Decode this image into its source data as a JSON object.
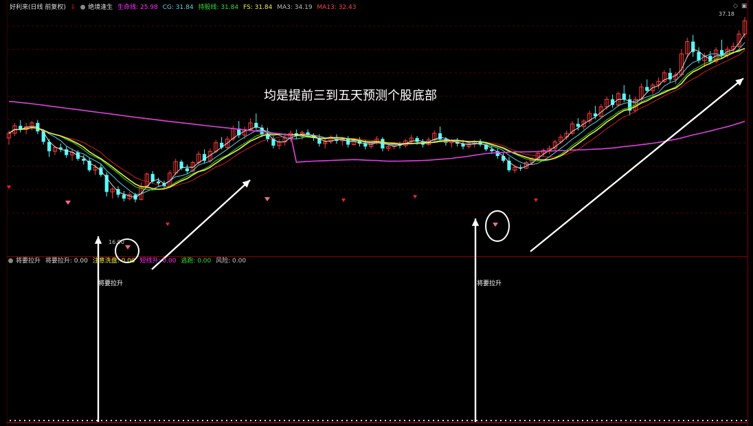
{
  "header": {
    "stock_title": "好利来(日线 前复权)",
    "indicator_name": "绝境逢生",
    "shengming_label": "生命线: 25.98",
    "cg_label": "CG: 31.84",
    "chigu_label": "持股线: 31.84",
    "fs_label": "FS: 31.84",
    "ma3_label": "MA3: 34.19",
    "ma13_label": "MA13: 32.43"
  },
  "sub_header": {
    "indicator_name": "将要拉升",
    "jiangyao_label": "将要拉升: 0.00",
    "zhuyi_label": "注意洗盘: 0.00",
    "jianting_label": "短线升: 0.00",
    "taopao_label": "逃跑: 0.00",
    "fengxian_label": "风险: 0.00"
  },
  "top_right": {
    "icon1": "◇",
    "icon2": "▣"
  },
  "chart_data": {
    "type": "candlestick",
    "title": "",
    "price_max_label": "37.18",
    "price_min_label": "16.90",
    "annotation": "均是提前三到五天预测个股底部",
    "signal_label": "将要拉升",
    "ylim": [
      14.0,
      39.0
    ],
    "candles": [
      [
        26.0,
        26.8,
        25.3,
        26.5
      ],
      [
        26.5,
        27.6,
        26.2,
        27.3
      ],
      [
        27.3,
        27.9,
        26.6,
        26.9
      ],
      [
        26.9,
        27.6,
        26.4,
        27.2
      ],
      [
        27.2,
        27.8,
        26.8,
        27.6
      ],
      [
        27.6,
        27.9,
        26.4,
        26.7
      ],
      [
        26.7,
        26.9,
        25.3,
        25.6
      ],
      [
        25.6,
        25.9,
        24.0,
        24.6
      ],
      [
        24.6,
        25.2,
        24.2,
        25.0
      ],
      [
        25.0,
        25.4,
        24.5,
        24.8
      ],
      [
        24.8,
        25.1,
        23.9,
        24.2
      ],
      [
        24.2,
        24.9,
        23.6,
        24.5
      ],
      [
        24.5,
        24.7,
        23.6,
        23.8
      ],
      [
        23.8,
        24.2,
        23.2,
        23.6
      ],
      [
        23.6,
        23.9,
        22.4,
        22.6
      ],
      [
        22.6,
        23.2,
        22.1,
        22.9
      ],
      [
        22.9,
        23.2,
        21.9,
        22.1
      ],
      [
        22.1,
        22.4,
        19.8,
        20.3
      ],
      [
        20.3,
        20.8,
        19.6,
        20.6
      ],
      [
        20.6,
        20.9,
        19.7,
        20.0
      ],
      [
        20.0,
        20.4,
        19.3,
        19.6
      ],
      [
        19.6,
        20.3,
        19.4,
        20.0
      ],
      [
        20.0,
        20.2,
        19.2,
        19.5
      ],
      [
        19.5,
        21.3,
        19.4,
        20.9
      ],
      [
        20.9,
        22.4,
        20.7,
        22.2
      ],
      [
        22.2,
        22.5,
        21.2,
        21.4
      ],
      [
        21.4,
        21.8,
        20.8,
        21.2
      ],
      [
        21.2,
        21.5,
        20.6,
        20.9
      ],
      [
        20.9,
        22.6,
        20.8,
        22.3
      ],
      [
        22.3,
        23.8,
        22.1,
        23.5
      ],
      [
        23.5,
        23.7,
        22.6,
        22.8
      ],
      [
        22.8,
        23.2,
        22.2,
        22.5
      ],
      [
        22.5,
        23.6,
        22.4,
        23.4
      ],
      [
        23.4,
        24.6,
        23.2,
        24.3
      ],
      [
        24.3,
        24.8,
        23.3,
        23.6
      ],
      [
        23.6,
        24.9,
        23.4,
        24.6
      ],
      [
        24.6,
        25.8,
        24.4,
        25.5
      ],
      [
        25.5,
        26.1,
        24.8,
        25.0
      ],
      [
        25.0,
        26.2,
        24.8,
        25.9
      ],
      [
        25.9,
        27.3,
        25.7,
        27.0
      ],
      [
        27.0,
        27.8,
        26.0,
        26.3
      ],
      [
        26.3,
        27.2,
        25.9,
        26.9
      ],
      [
        26.9,
        28.1,
        26.7,
        27.6
      ],
      [
        27.6,
        28.6,
        26.9,
        27.1
      ],
      [
        27.1,
        27.4,
        26.1,
        26.4
      ],
      [
        26.4,
        27.1,
        25.6,
        25.9
      ],
      [
        25.9,
        26.2,
        24.9,
        25.2
      ],
      [
        25.2,
        25.9,
        24.8,
        25.6
      ],
      [
        25.6,
        26.3,
        25.2,
        26.0
      ],
      [
        26.0,
        26.8,
        25.6,
        26.5
      ],
      [
        26.5,
        26.9,
        25.9,
        26.2
      ],
      [
        26.2,
        26.8,
        25.8,
        26.6
      ],
      [
        26.6,
        26.9,
        26.1,
        26.3
      ],
      [
        26.3,
        26.5,
        25.7,
        26.0
      ],
      [
        26.0,
        26.4,
        25.1,
        25.4
      ],
      [
        25.4,
        25.9,
        24.9,
        25.6
      ],
      [
        25.6,
        26.3,
        25.4,
        26.1
      ],
      [
        26.1,
        26.4,
        25.4,
        25.7
      ],
      [
        25.7,
        26.1,
        25.2,
        25.9
      ],
      [
        25.9,
        26.2,
        25.0,
        25.3
      ],
      [
        25.3,
        26.0,
        25.2,
        25.8
      ],
      [
        25.8,
        26.1,
        25.1,
        25.4
      ],
      [
        25.4,
        25.8,
        24.8,
        25.1
      ],
      [
        25.1,
        25.6,
        24.9,
        25.5
      ],
      [
        25.5,
        26.2,
        25.3,
        25.9
      ],
      [
        25.9,
        26.1,
        24.6,
        24.9
      ],
      [
        24.9,
        25.3,
        24.6,
        25.1
      ],
      [
        25.1,
        25.6,
        24.8,
        25.4
      ],
      [
        25.4,
        25.6,
        24.9,
        25.2
      ],
      [
        25.2,
        25.9,
        25.0,
        25.7
      ],
      [
        25.7,
        26.3,
        25.4,
        26.0
      ],
      [
        26.0,
        26.2,
        25.3,
        25.6
      ],
      [
        25.6,
        25.9,
        25.0,
        25.3
      ],
      [
        25.3,
        26.1,
        25.2,
        25.8
      ],
      [
        25.8,
        26.8,
        25.6,
        26.5
      ],
      [
        26.5,
        27.2,
        25.6,
        25.9
      ],
      [
        25.9,
        26.1,
        25.2,
        25.5
      ],
      [
        25.5,
        25.9,
        25.0,
        25.7
      ],
      [
        25.7,
        26.0,
        25.1,
        25.4
      ],
      [
        25.4,
        25.8,
        24.8,
        25.1
      ],
      [
        25.1,
        25.7,
        24.9,
        25.4
      ],
      [
        25.4,
        25.8,
        25.0,
        25.6
      ],
      [
        25.6,
        25.9,
        25.1,
        25.3
      ],
      [
        25.3,
        25.6,
        24.6,
        24.8
      ],
      [
        24.8,
        25.2,
        24.3,
        24.6
      ],
      [
        24.6,
        24.9,
        23.8,
        24.1
      ],
      [
        24.1,
        24.4,
        23.4,
        23.6
      ],
      [
        23.6,
        24.0,
        22.4,
        22.6
      ],
      [
        22.6,
        23.1,
        22.3,
        22.9
      ],
      [
        22.9,
        23.2,
        22.5,
        22.8
      ],
      [
        22.8,
        23.6,
        22.7,
        23.4
      ],
      [
        23.4,
        24.0,
        23.2,
        23.8
      ],
      [
        23.8,
        24.6,
        23.6,
        24.4
      ],
      [
        24.4,
        24.9,
        24.0,
        24.7
      ],
      [
        24.7,
        25.2,
        24.3,
        24.9
      ],
      [
        24.9,
        25.8,
        24.7,
        25.6
      ],
      [
        25.6,
        26.4,
        25.4,
        26.1
      ],
      [
        26.1,
        26.8,
        25.8,
        26.5
      ],
      [
        26.5,
        27.8,
        26.3,
        27.5
      ],
      [
        27.5,
        28.1,
        26.8,
        27.2
      ],
      [
        27.2,
        28.0,
        26.9,
        27.8
      ],
      [
        27.8,
        28.9,
        27.5,
        28.6
      ],
      [
        28.6,
        29.4,
        28.0,
        28.3
      ],
      [
        28.3,
        29.6,
        28.1,
        29.3
      ],
      [
        29.3,
        30.4,
        29.0,
        30.1
      ],
      [
        30.1,
        30.6,
        29.2,
        29.5
      ],
      [
        29.5,
        30.9,
        29.3,
        30.7
      ],
      [
        30.7,
        31.6,
        29.8,
        30.1
      ],
      [
        30.1,
        30.6,
        28.4,
        28.9
      ],
      [
        28.9,
        30.4,
        28.7,
        30.1
      ],
      [
        30.1,
        31.8,
        29.9,
        31.4
      ],
      [
        31.4,
        32.2,
        30.8,
        31.0
      ],
      [
        31.0,
        31.8,
        30.6,
        31.6
      ],
      [
        31.6,
        32.4,
        31.2,
        32.0
      ],
      [
        32.0,
        33.2,
        31.8,
        32.9
      ],
      [
        32.9,
        33.4,
        31.9,
        32.2
      ],
      [
        32.2,
        33.0,
        31.7,
        32.7
      ],
      [
        32.7,
        35.4,
        32.5,
        34.9
      ],
      [
        34.9,
        36.6,
        34.5,
        36.2
      ],
      [
        36.2,
        36.9,
        34.6,
        35.1
      ],
      [
        35.1,
        35.6,
        33.9,
        34.2
      ],
      [
        34.2,
        35.0,
        33.5,
        34.7
      ],
      [
        34.7,
        35.2,
        33.8,
        34.1
      ],
      [
        34.1,
        35.6,
        33.9,
        35.3
      ],
      [
        35.3,
        36.4,
        34.4,
        34.8
      ],
      [
        34.8,
        35.7,
        34.5,
        35.4
      ],
      [
        35.4,
        36.1,
        34.9,
        35.7
      ],
      [
        35.7,
        37.4,
        35.5,
        37.0
      ],
      [
        37.0,
        38.8,
        36.6,
        38.4
      ]
    ]
  }
}
